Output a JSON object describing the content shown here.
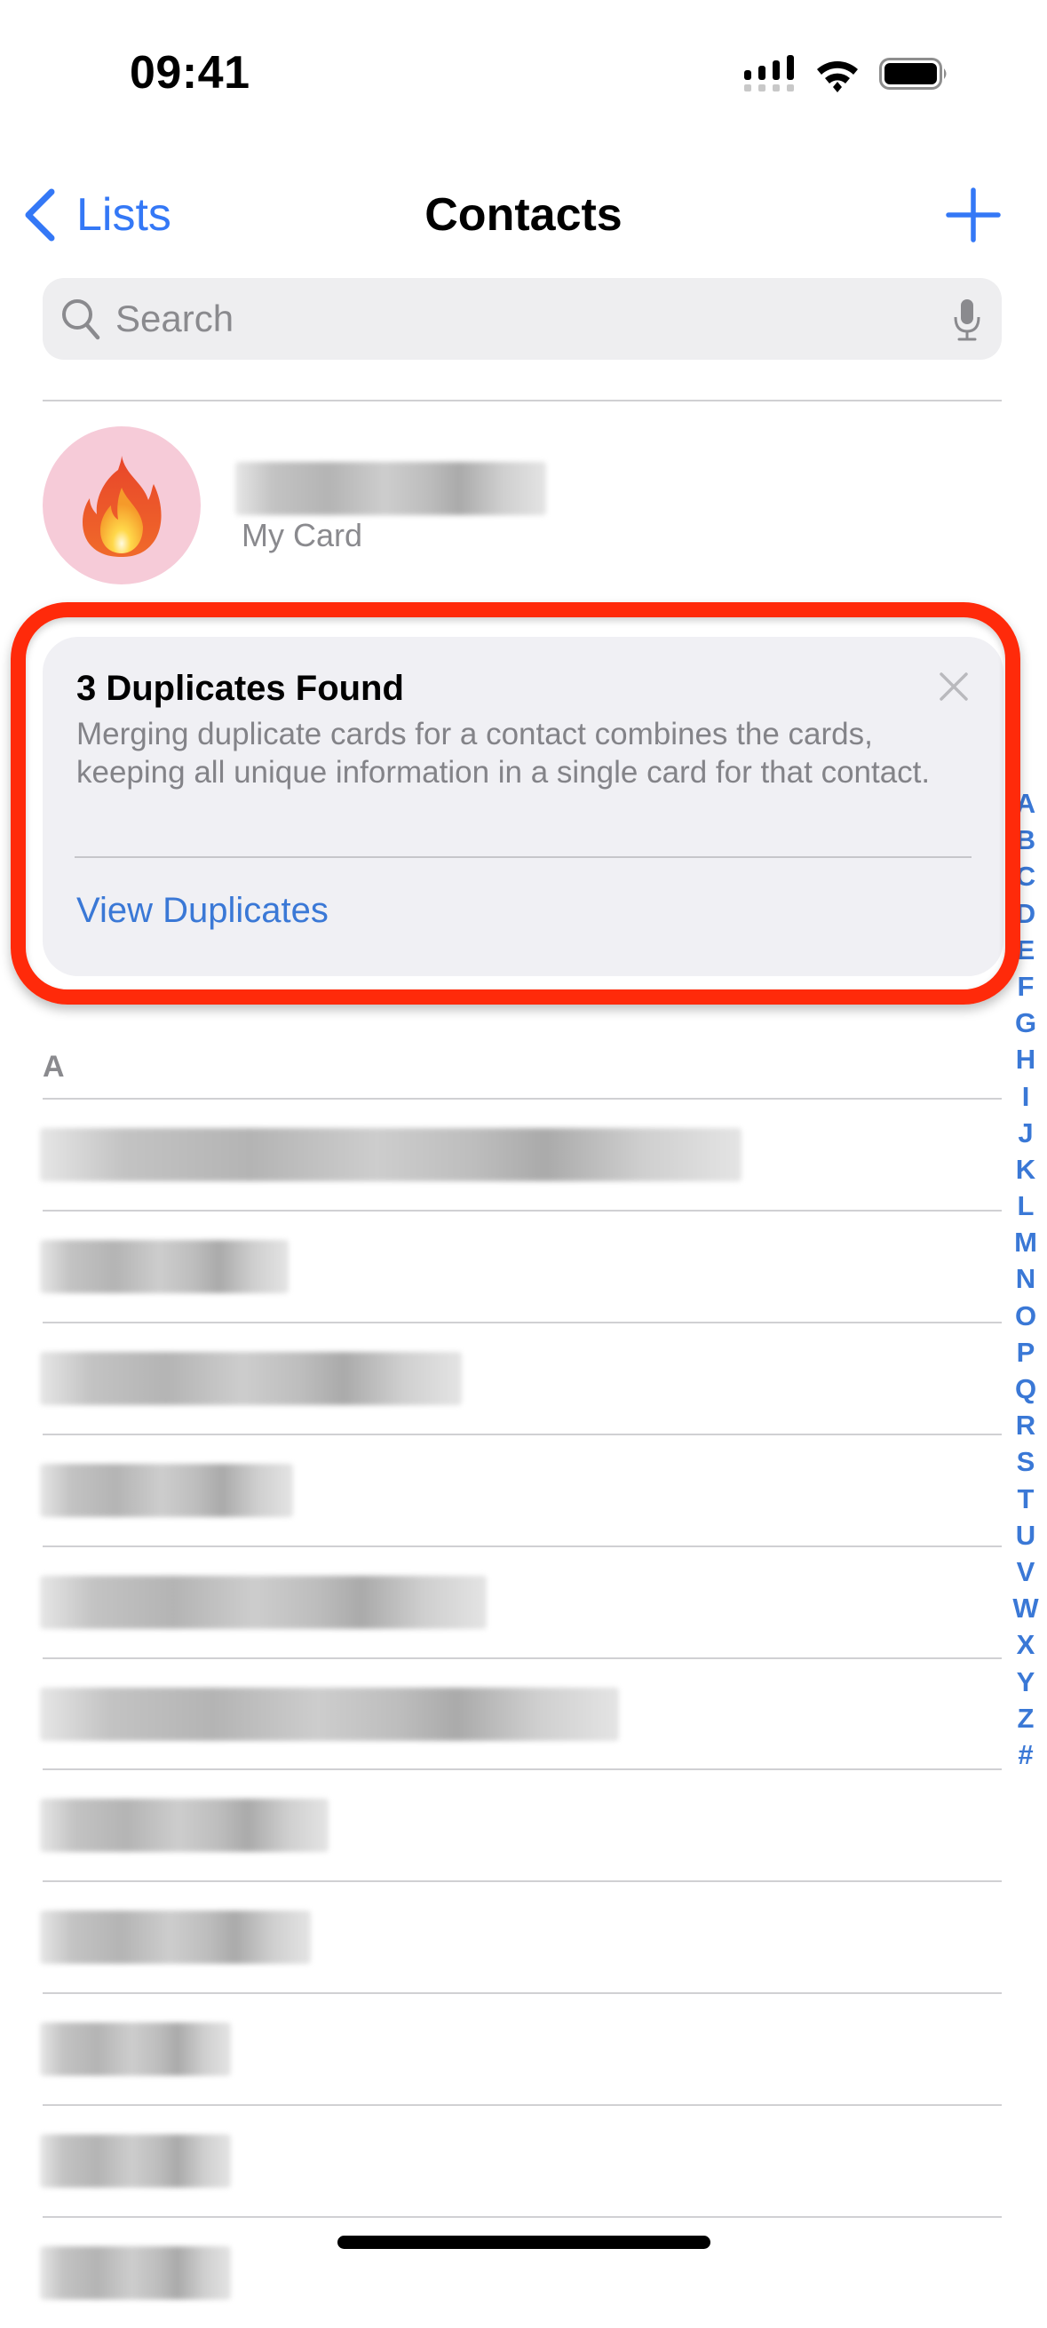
{
  "status_bar": {
    "time": "09:41",
    "icons": [
      "cellular-signal-icon",
      "wifi-icon",
      "battery-icon"
    ]
  },
  "nav": {
    "back_label": "Lists",
    "back_icon": "chevron-left-icon",
    "title": "Contacts",
    "add_icon": "plus-icon"
  },
  "search": {
    "value": "",
    "placeholder": "Search",
    "icon": "magnifying-glass-icon",
    "mic_icon": "microphone-icon"
  },
  "my_card": {
    "avatar_emoji": "fire-emoji",
    "name_redacted": true,
    "label": "My Card"
  },
  "duplicates_card": {
    "title": "3 Duplicates Found",
    "body": "Merging duplicate cards for a contact combines the cards, keeping all unique information in a single card for that contact.",
    "action": "View Duplicates",
    "close_icon": "close-icon",
    "highlighted": true
  },
  "section_index": [
    "A",
    "B",
    "C",
    "D",
    "E",
    "F",
    "G",
    "H",
    "I",
    "J",
    "K",
    "L",
    "M",
    "N",
    "O",
    "P",
    "Q",
    "R",
    "S",
    "T",
    "U",
    "V",
    "W",
    "X",
    "Y",
    "Z",
    "#"
  ],
  "contacts": {
    "section_header": "A",
    "rows": [
      {
        "name_redacted": true
      },
      {
        "name_redacted": true
      },
      {
        "name_redacted": true
      },
      {
        "name_redacted": true
      },
      {
        "name_redacted": true
      },
      {
        "name_redacted": true
      },
      {
        "name_redacted": true
      },
      {
        "name_redacted": true
      },
      {
        "name_redacted": true
      },
      {
        "name_redacted": true
      },
      {
        "name_redacted": true
      }
    ]
  },
  "colors": {
    "accent": "#3478f6",
    "highlight_border": "#ff2a0a",
    "card_background": "#f0f0f4",
    "secondary_text": "#8a8a8e"
  }
}
